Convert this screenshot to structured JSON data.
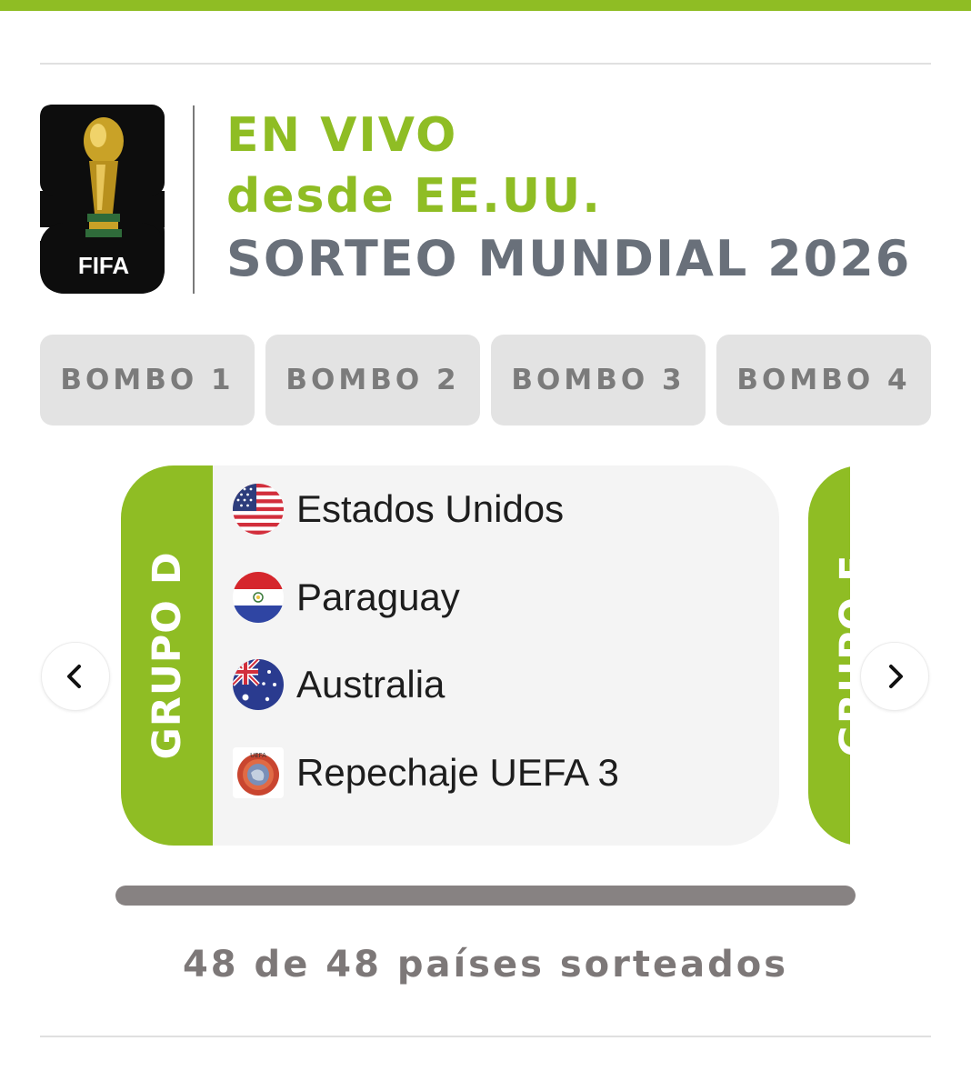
{
  "header": {
    "logo_wordmark": "FIFA",
    "line1": "EN VIVO",
    "line2": "desde EE.UU.",
    "line3": "SORTEO MUNDIAL 2026"
  },
  "tabs": [
    {
      "label": "BOMBO 1"
    },
    {
      "label": "BOMBO 2"
    },
    {
      "label": "BOMBO 3"
    },
    {
      "label": "BOMBO 4"
    }
  ],
  "group": {
    "title": "GRUPO D",
    "teams": [
      {
        "name": "Estados Unidos",
        "flag": "usa-flag-icon"
      },
      {
        "name": "Paraguay",
        "flag": "paraguay-flag-icon"
      },
      {
        "name": "Australia",
        "flag": "australia-flag-icon"
      },
      {
        "name": "Repechaje UEFA 3",
        "flag": "uefa-logo-icon"
      }
    ]
  },
  "next_group": {
    "title": "GRUPO E"
  },
  "progress": {
    "value": 1.0,
    "label": "48 de 48 países sorteados"
  },
  "colors": {
    "accent": "#8fbd24",
    "title_gray": "#69707a",
    "tab_bg": "#e3e3e3"
  }
}
